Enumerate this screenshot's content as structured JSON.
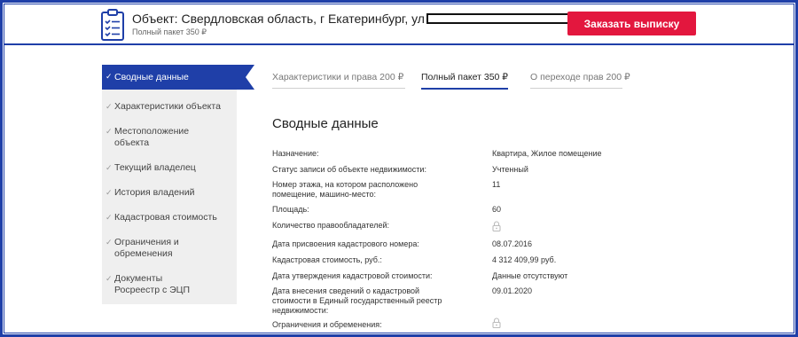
{
  "header": {
    "object_title": "Объект: Свердловская область, г Екатеринбург, ул",
    "package_subtitle": "Полный пакет 350 ₽",
    "order_button": "Заказать выписку",
    "icon": "clipboard-checklist-icon"
  },
  "sidebar": {
    "items": [
      {
        "label": "Сводные данные",
        "active": true
      },
      {
        "label": "Характеристики объекта",
        "active": false
      },
      {
        "label": "Местоположение объекта",
        "active": false
      },
      {
        "label": "Текущий владелец",
        "active": false
      },
      {
        "label": "История владений",
        "active": false
      },
      {
        "label": "Кадастровая стоимость",
        "active": false
      },
      {
        "label": "Ограничения и обременения",
        "active": false
      },
      {
        "label": "Документы Росреестр с ЭЦП",
        "active": false
      }
    ]
  },
  "tabs": [
    {
      "label": "Характеристики и права 200 ₽",
      "active": false
    },
    {
      "label": "Полный пакет 350 ₽",
      "active": true
    },
    {
      "label": "О переходе прав 200 ₽",
      "active": false
    }
  ],
  "main": {
    "title": "Сводные данные",
    "rows": [
      {
        "label": "Назначение:",
        "value": "Квартира, Жилое помещение"
      },
      {
        "label": "Статус записи об объекте недвижимости:",
        "value": "Учтенный"
      },
      {
        "label": "Номер этажа, на котором расположено помещение, машино-место:",
        "value": "11"
      },
      {
        "label": "Площадь:",
        "value": "60"
      },
      {
        "label": "Количество правообладателей:",
        "value": "",
        "locked": true
      },
      {
        "label": "Дата присвоения кадастрового номера:",
        "value": "08.07.2016"
      },
      {
        "label": "Кадастровая стоимость, руб.:",
        "value": "4 312 409,99 руб."
      },
      {
        "label": "Дата утверждения кадастровой стоимости:",
        "value": "Данные отсутствуют"
      },
      {
        "label": "Дата внесения сведений о кадастровой стоимости в Единый государственный реестр недвижимости:",
        "value": "09.01.2020"
      },
      {
        "label": "Ограничения и обременения:",
        "value": "",
        "locked": true
      }
    ],
    "lock_icon": "lock-icon"
  },
  "colors": {
    "brand_blue": "#1f3fa8",
    "accent_red": "#e3173e",
    "sidebar_bg": "#efefef"
  }
}
